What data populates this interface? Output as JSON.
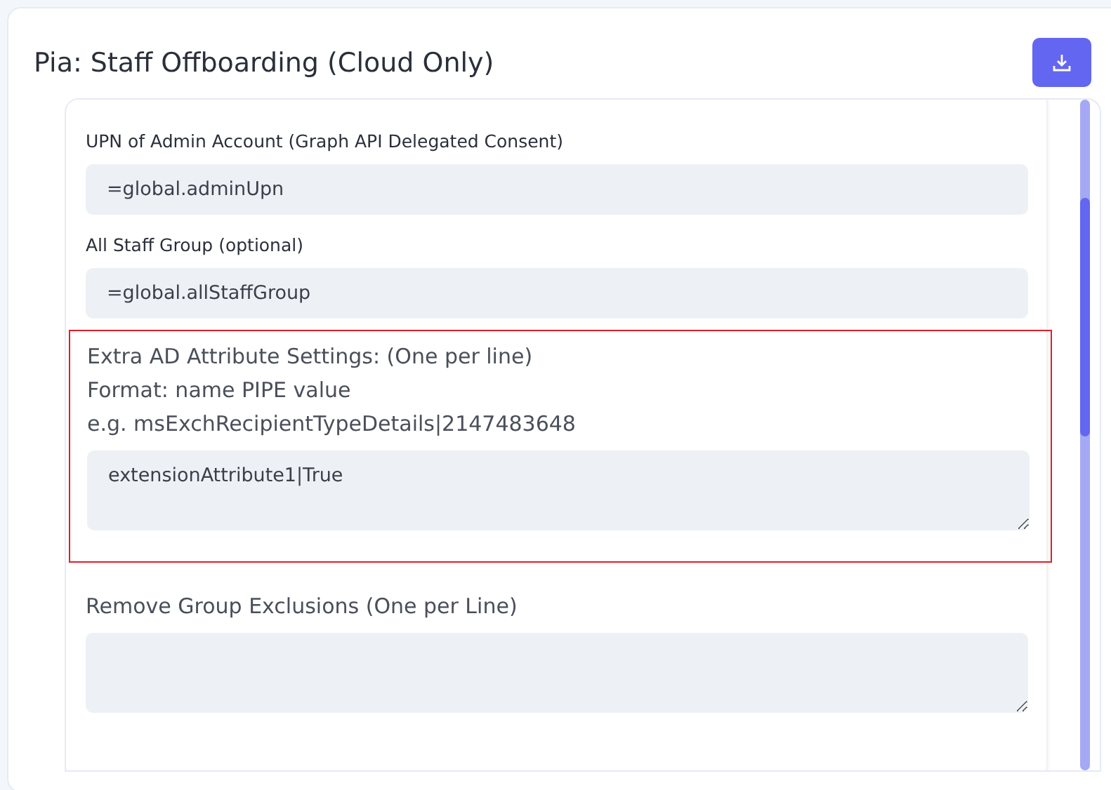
{
  "title": "Pia: Staff Offboarding (Cloud Only)",
  "fields": [
    {
      "kind": "input",
      "label_lines": [
        "UPN of Admin Account (Graph API Delegated Consent)"
      ],
      "value": "=global.adminUpn",
      "highlighted": false
    },
    {
      "kind": "input",
      "label_lines": [
        "All Staff Group (optional)"
      ],
      "value": "=global.allStaffGroup",
      "highlighted": false
    },
    {
      "kind": "textarea",
      "label_lines": [
        "Extra AD Attribute Settings: (One per line)",
        "Format: name PIPE value",
        "e.g. msExchRecipientTypeDetails|2147483648"
      ],
      "value": "extensionAttribute1|True",
      "highlighted": true
    },
    {
      "kind": "textarea",
      "label_lines": [
        "Remove Group Exclusions (One per Line)"
      ],
      "highlighted": false
    }
  ]
}
